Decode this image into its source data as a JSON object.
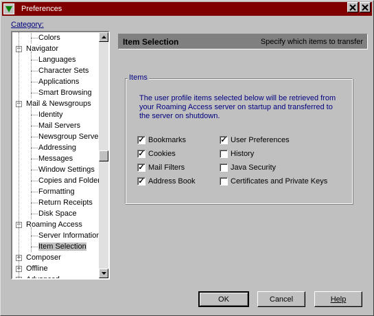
{
  "window": {
    "title": "Preferences"
  },
  "titlebar": {
    "help_glyph": "?",
    "close_glyph": "✕"
  },
  "category": {
    "label": "Category:"
  },
  "tree": [
    {
      "label": "Colors",
      "level": 2,
      "exp": ""
    },
    {
      "label": "Navigator",
      "level": 1,
      "exp": "−"
    },
    {
      "label": "Languages",
      "level": 2,
      "exp": ""
    },
    {
      "label": "Character Sets",
      "level": 2,
      "exp": ""
    },
    {
      "label": "Applications",
      "level": 2,
      "exp": ""
    },
    {
      "label": "Smart Browsing",
      "level": 2,
      "exp": ""
    },
    {
      "label": "Mail & Newsgroups",
      "level": 1,
      "exp": "−"
    },
    {
      "label": "Identity",
      "level": 2,
      "exp": ""
    },
    {
      "label": "Mail Servers",
      "level": 2,
      "exp": ""
    },
    {
      "label": "Newsgroup Servers",
      "level": 2,
      "exp": ""
    },
    {
      "label": "Addressing",
      "level": 2,
      "exp": ""
    },
    {
      "label": "Messages",
      "level": 2,
      "exp": ""
    },
    {
      "label": "Window Settings",
      "level": 2,
      "exp": ""
    },
    {
      "label": "Copies and Folders",
      "level": 2,
      "exp": ""
    },
    {
      "label": "Formatting",
      "level": 2,
      "exp": ""
    },
    {
      "label": "Return Receipts",
      "level": 2,
      "exp": ""
    },
    {
      "label": "Disk Space",
      "level": 2,
      "exp": ""
    },
    {
      "label": "Roaming Access",
      "level": 1,
      "exp": "−"
    },
    {
      "label": "Server Information",
      "level": 2,
      "exp": ""
    },
    {
      "label": "Item Selection",
      "level": 2,
      "exp": "",
      "selected": true
    },
    {
      "label": "Composer",
      "level": 1,
      "exp": "+"
    },
    {
      "label": "Offline",
      "level": 1,
      "exp": "+"
    },
    {
      "label": "Advanced",
      "level": 1,
      "exp": "+"
    }
  ],
  "panel": {
    "title": "Item Selection",
    "subtitle": "Specify which items to transfer"
  },
  "items": {
    "legend": "Items",
    "description": "The user profile items selected below will be retrieved from your Roaming Access server on startup and transferred to the server on shutdown.",
    "left": [
      {
        "label": "Bookmarks",
        "checked": true
      },
      {
        "label": "Cookies",
        "checked": true
      },
      {
        "label": "Mail Filters",
        "checked": true
      },
      {
        "label": "Address Book",
        "checked": true
      }
    ],
    "right": [
      {
        "label": "User Preferences",
        "checked": true
      },
      {
        "label": "History",
        "checked": false
      },
      {
        "label": "Java Security",
        "checked": false
      },
      {
        "label": "Certificates and Private Keys",
        "checked": false
      }
    ]
  },
  "buttons": {
    "ok": "OK",
    "cancel": "Cancel",
    "help": "Help"
  },
  "colors": {
    "titlebar": "#800000",
    "face": "#c0c0c0",
    "label_blue": "#000080"
  }
}
